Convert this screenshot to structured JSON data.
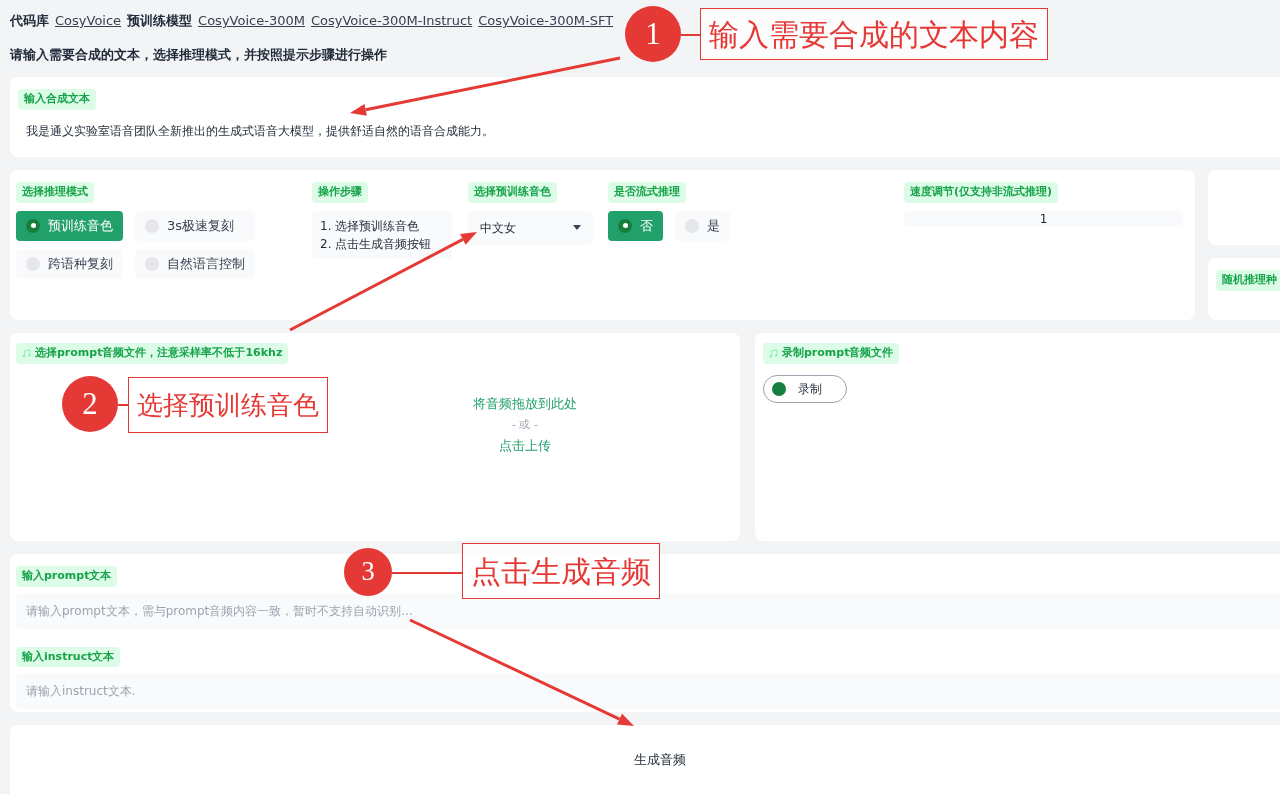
{
  "header": [
    {
      "kind": "label",
      "text": "代码库"
    },
    {
      "kind": "link",
      "text": "CosyVoice"
    },
    {
      "kind": "label",
      "text": "预训练模型"
    },
    {
      "kind": "link",
      "text": "CosyVoice-300M"
    },
    {
      "kind": "link",
      "text": "CosyVoice-300M-Instruct"
    },
    {
      "kind": "link",
      "text": "CosyVoice-300M-SFT"
    }
  ],
  "instruction": "请输入需要合成的文本，选择推理模式，并按照提示步骤进行操作",
  "input_text": {
    "label": "输入合成文本",
    "value": "我是通义实验室语音团队全新推出的生成式语音大模型，提供舒适自然的语音合成能力。"
  },
  "mode": {
    "label": "选择推理模式",
    "options": [
      {
        "label": "预训练音色",
        "selected": true
      },
      {
        "label": "3s极速复刻",
        "selected": false
      },
      {
        "label": "跨语种复刻",
        "selected": false
      },
      {
        "label": "自然语言控制",
        "selected": false
      }
    ]
  },
  "steps": {
    "label": "操作步骤",
    "lines": [
      "1. 选择预训练音色",
      "2. 点击生成音频按钮"
    ]
  },
  "voice": {
    "label": "选择预训练音色",
    "value": "中文女"
  },
  "stream": {
    "label": "是否流式推理",
    "options": [
      {
        "label": "否",
        "selected": true
      },
      {
        "label": "是",
        "selected": false
      }
    ]
  },
  "speed": {
    "label": "速度调节(仅支持非流式推理)",
    "value": "1"
  },
  "seed": {
    "label": "随机推理种"
  },
  "prompt_audio": {
    "label": "选择prompt音频文件，注意采样率不低于16khz",
    "drop_text": "将音频拖放到此处",
    "or_text": "- 或 -",
    "upload": "点击上传"
  },
  "record": {
    "label": "录制prompt音频文件",
    "button": "录制"
  },
  "prompt_text": {
    "label": "输入prompt文本",
    "placeholder": "请输入prompt文本，需与prompt音频内容一致，暂时不支持自动识别..."
  },
  "instruct_text": {
    "label": "输入instruct文本",
    "placeholder": "请输入instruct文本."
  },
  "generate_button": "生成音频",
  "annotations": [
    {
      "number": "1",
      "text": "输入需要合成的文本内容"
    },
    {
      "number": "2",
      "text": "选择预训练音色"
    },
    {
      "number": "3",
      "text": "点击生成音频"
    }
  ]
}
